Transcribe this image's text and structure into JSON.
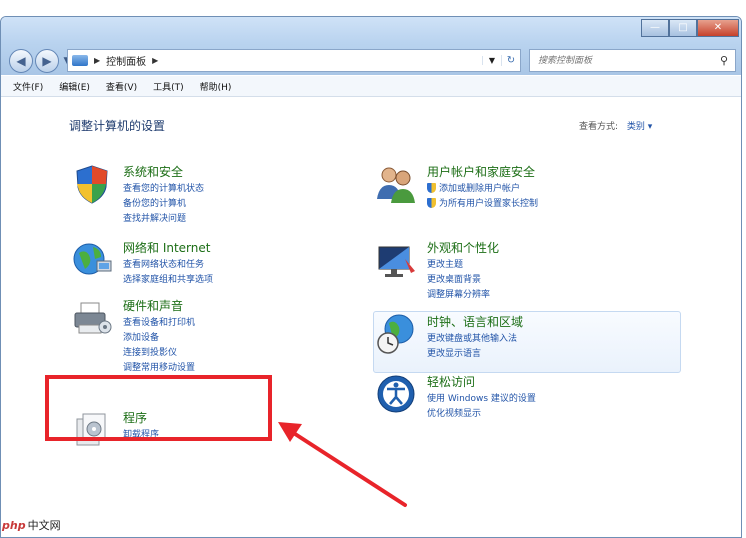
{
  "toolbar": {
    "address": "控制面板",
    "search_placeholder": "搜索控制面板"
  },
  "menu": [
    "文件(F)",
    "编辑(E)",
    "查看(V)",
    "工具(T)",
    "帮助(H)"
  ],
  "page": {
    "title": "调整计算机的设置",
    "view_by_label": "查看方式:",
    "view_by_value": "类别"
  },
  "categories_left": [
    {
      "title": "系统和安全",
      "links": [
        "查看您的计算机状态",
        "备份您的计算机",
        "查找并解决问题"
      ]
    },
    {
      "title": "网络和 Internet",
      "links": [
        "查看网络状态和任务",
        "选择家庭组和共享选项"
      ]
    },
    {
      "title": "硬件和声音",
      "links": [
        "查看设备和打印机",
        "添加设备",
        "连接到投影仪",
        "调整常用移动设置"
      ]
    },
    {
      "title": "程序",
      "links": [
        "卸载程序"
      ]
    }
  ],
  "categories_right": [
    {
      "title": "用户帐户和家庭安全",
      "links": [
        "添加或删除用户帐户",
        "为所有用户设置家长控制"
      ]
    },
    {
      "title": "外观和个性化",
      "links": [
        "更改主题",
        "更改桌面背景",
        "调整屏幕分辨率"
      ]
    },
    {
      "title": "时钟、语言和区域",
      "links": [
        "更改键盘或其他输入法",
        "更改显示语言"
      ]
    },
    {
      "title": "轻松访问",
      "links": [
        "使用 Windows 建议的设置",
        "优化视频显示"
      ]
    }
  ],
  "watermark": {
    "logo": "php",
    "brand": "中文网"
  },
  "colors": {
    "accent_red": "#e8242a",
    "link_blue": "#2254a8",
    "title_green": "#1c6e16"
  }
}
